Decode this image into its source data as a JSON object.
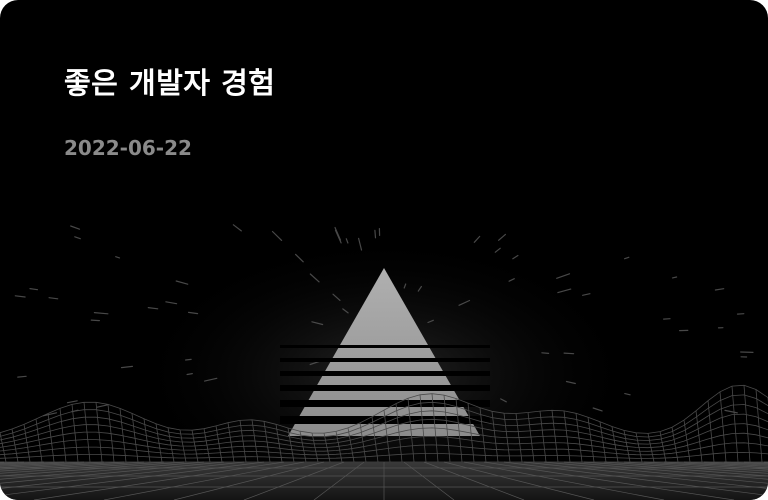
{
  "post": {
    "title": "좋은 개발자 경험",
    "date": "2022-06-22",
    "thumbnail_icon": "pyramid-grid-landscape-illustration"
  }
}
